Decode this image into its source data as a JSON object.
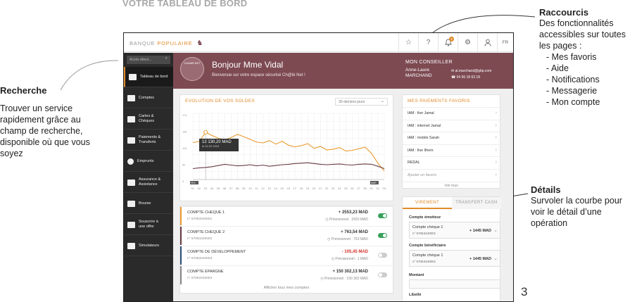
{
  "page_heading": "VOTRE TABLEAU DE BORD",
  "page_number": "3",
  "annotations": {
    "recherche": {
      "title": "Recherche",
      "lines": [
        "Trouver un service",
        "rapidement grâce au",
        "champ de recherche,",
        "disponible où que vous",
        "soyez"
      ]
    },
    "raccourcis": {
      "title": "Raccourcis",
      "lines": [
        "Des fonctionnalités",
        "accessibles sur toutes",
        "les pages :"
      ],
      "items": [
        "- Mes favoris",
        "- Aide",
        "- Notifications",
        "- Messagerie",
        "- Mon compte"
      ]
    },
    "details": {
      "title": "Détails",
      "lines": [
        "Survoler la courbe pour",
        "voir le détail d’une",
        "opération"
      ]
    }
  },
  "app": {
    "logo_part1": "BANQUE ",
    "logo_part2": "POPULAIRE",
    "lang": "FR",
    "notif_count": "3",
    "search_placeholder": "Accès direct...",
    "sidebar": [
      {
        "label": "Tableau de bord",
        "active": true
      },
      {
        "label": "Comptes"
      },
      {
        "label": "Cartes & Chèques"
      },
      {
        "label": "Paiements & Transferts"
      },
      {
        "label": "Emprunts"
      },
      {
        "label": "Assurance & Assistance"
      },
      {
        "label": "Bourse"
      },
      {
        "label": "Souscrire à une offre"
      },
      {
        "label": "Simulateurs"
      }
    ],
    "header": {
      "greeting": "Bonjour Mme Vidal",
      "subtitle": "Bienvenue sur votre espace sécurisé Ch@bi Net !",
      "logo_text": "CHAABI NET",
      "advisor_title": "MON CONSEILLER",
      "advisor_first": "Anne-Laure",
      "advisor_last": "MARCHAND",
      "advisor_email": "al.marchand@gbp.com",
      "advisor_phone": "04 66 18 63 18"
    },
    "evolution": {
      "title": "EVOLUTION DE VOS SOLDES",
      "period": "30 derniers jours",
      "tooltip_value": "12 130,20 MAD",
      "tooltip_date": "le 02.02.2015",
      "month_start": "FEV",
      "month_end": "MAR",
      "day_ticks": [
        "01",
        "02",
        "03",
        "04",
        "05",
        "06",
        "07",
        "08",
        "09",
        "10",
        "11",
        "12",
        "13",
        "14",
        "15",
        "16",
        "17",
        "18",
        "19",
        "20",
        "21",
        "22",
        "23",
        "24",
        "25",
        "26",
        "27",
        "28",
        "01",
        "02",
        "03"
      ],
      "y_ticks": [
        "17k",
        "15k",
        "10k",
        "5k",
        "0"
      ]
    },
    "chart_data": {
      "type": "line",
      "title": "EVOLUTION DE VOS SOLDES",
      "x": [
        "01",
        "02",
        "03",
        "04",
        "05",
        "06",
        "07",
        "08",
        "09",
        "10",
        "11",
        "12",
        "13",
        "14",
        "15",
        "16",
        "17",
        "18",
        "19",
        "20",
        "21",
        "22",
        "23",
        "24",
        "25",
        "26",
        "27",
        "28",
        "01",
        "02",
        "03"
      ],
      "ylim": [
        0,
        17000
      ],
      "series": [
        {
          "color": "#e89a2e",
          "values": [
            9500,
            9800,
            12130,
            11300,
            10600,
            10200,
            10800,
            11600,
            11000,
            10300,
            9600,
            9400,
            10000,
            9100,
            9800,
            8800,
            8400,
            8700,
            9200,
            8000,
            8500,
            7600,
            7800,
            8200,
            7300,
            7500,
            7900,
            8300,
            6700,
            4200,
            2200
          ]
        },
        {
          "color": "#6a3b43",
          "values": [
            2800,
            3000,
            3100,
            3300,
            3600,
            3900,
            3700,
            3500,
            3600,
            3800,
            3500,
            3700,
            3400,
            3600,
            3800,
            3900,
            4100,
            4200,
            4300,
            4100,
            3900,
            3800,
            3900,
            4000,
            3800,
            3700,
            3900,
            4000,
            3900,
            3400,
            2800
          ]
        }
      ]
    },
    "favoris": {
      "title": "MES PAIEMENTS FAVORIS",
      "items": [
        "IAM : fixe Jamal",
        "IAM : internet Jamal",
        "IAM : mobile Sarah",
        "IAM : fixe Ilhem",
        "REDAL"
      ],
      "add": "Ajouter un favoris",
      "all": "Voir tous"
    },
    "accounts": [
      {
        "name": "COMPTE CHEQUE 1",
        "number": "n° 57063440001",
        "amount": "+ 2553,23 MAD",
        "forecast": "Prévisionnel : 2420 MAD",
        "color": "#e89a2e",
        "on": true,
        "neg": false
      },
      {
        "name": "COMPTE CHEQUE 2",
        "number": "n° 57063440002",
        "amount": "+ 763,54 MAD",
        "forecast": "Prévisionnel : 763 MAD",
        "color": "#6a3b43",
        "on": true,
        "neg": false
      },
      {
        "name": "COMPTE DE DÉVELOPPEMENT",
        "number": "n° 57063440003",
        "amount": "- 105,45 MAD",
        "forecast": "Prévisionnel : 1 MAD",
        "color": "#2a4f7a",
        "on": false,
        "neg": true
      },
      {
        "name": "COMPTE ÉPARGNE",
        "number": "n° 57063440004",
        "amount": "+ 150 302,13 MAD",
        "forecast": "Prévisionnel : 150 302 MAD",
        "color": "#888888",
        "on": false,
        "neg": false
      }
    ],
    "accounts_all": "Afficher tous mes comptes",
    "virement": {
      "tab1": "VIREMENT",
      "tab2": "TRANSFERT CASH",
      "label_from": "Compte émetteur",
      "from_name": "Compte chèque 1",
      "from_no": "n° 57063440001",
      "from_amount": "+ 1445 MAD",
      "label_to": "Compte  bénéficiaire",
      "to_name": "Compte chèque 1",
      "to_no": "n° 57063440001",
      "to_amount": "+ 1445 MAD",
      "label_amount": "Montant",
      "label_libelle": "Libellé"
    }
  }
}
